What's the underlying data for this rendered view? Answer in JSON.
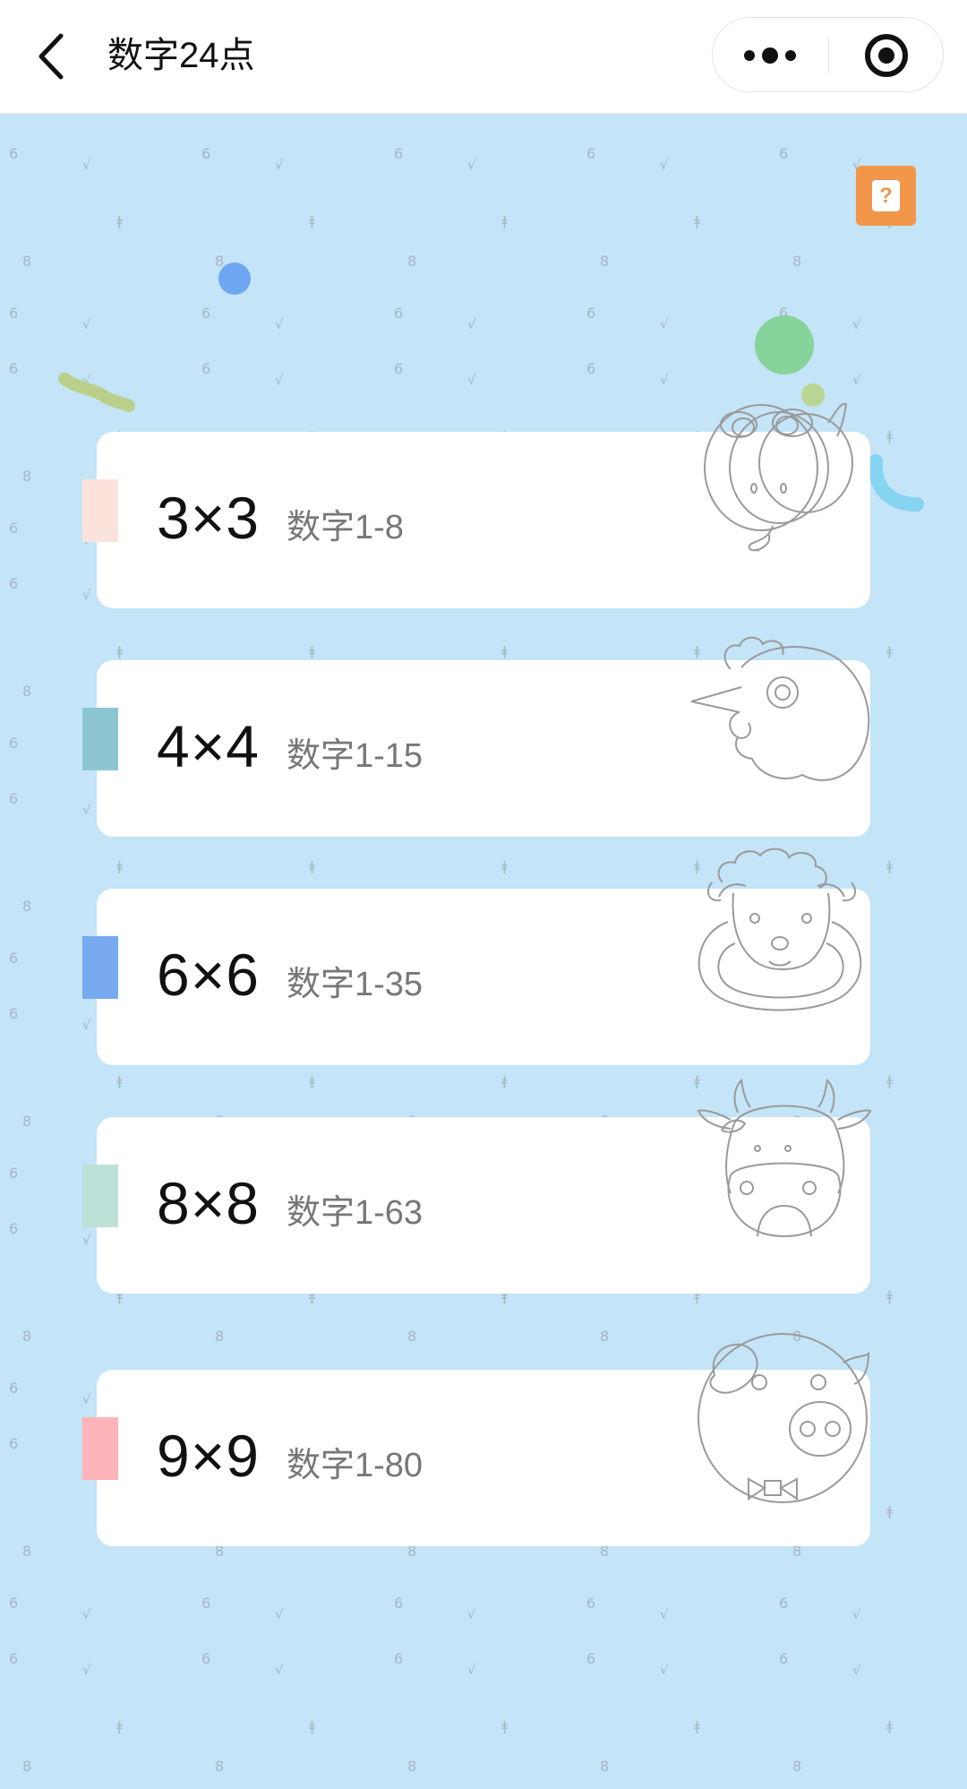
{
  "navbar": {
    "title": "数字24点",
    "back_icon": "chevron-left-icon",
    "more_icon": "more-dots-icon",
    "close_icon": "target-icon"
  },
  "help": {
    "label": "?"
  },
  "levels": [
    {
      "size": "3×3",
      "range": "数字1-8",
      "tag_color": "#fbe3dc",
      "animal": "snake-icon"
    },
    {
      "size": "4×4",
      "range": "数字1-15",
      "tag_color": "#8cc6d1",
      "animal": "chicken-icon"
    },
    {
      "size": "6×6",
      "range": "数字1-35",
      "tag_color": "#78aaf0",
      "animal": "sheep-icon"
    },
    {
      "size": "8×8",
      "range": "数字1-63",
      "tag_color": "#bde0d8",
      "animal": "cow-icon"
    },
    {
      "size": "9×9",
      "range": "数字1-80",
      "tag_color": "#feb4b8",
      "animal": "pig-icon"
    }
  ],
  "colors": {
    "background": "#c4e4f7",
    "help_button": "#f2974a",
    "card": "#ffffff"
  }
}
